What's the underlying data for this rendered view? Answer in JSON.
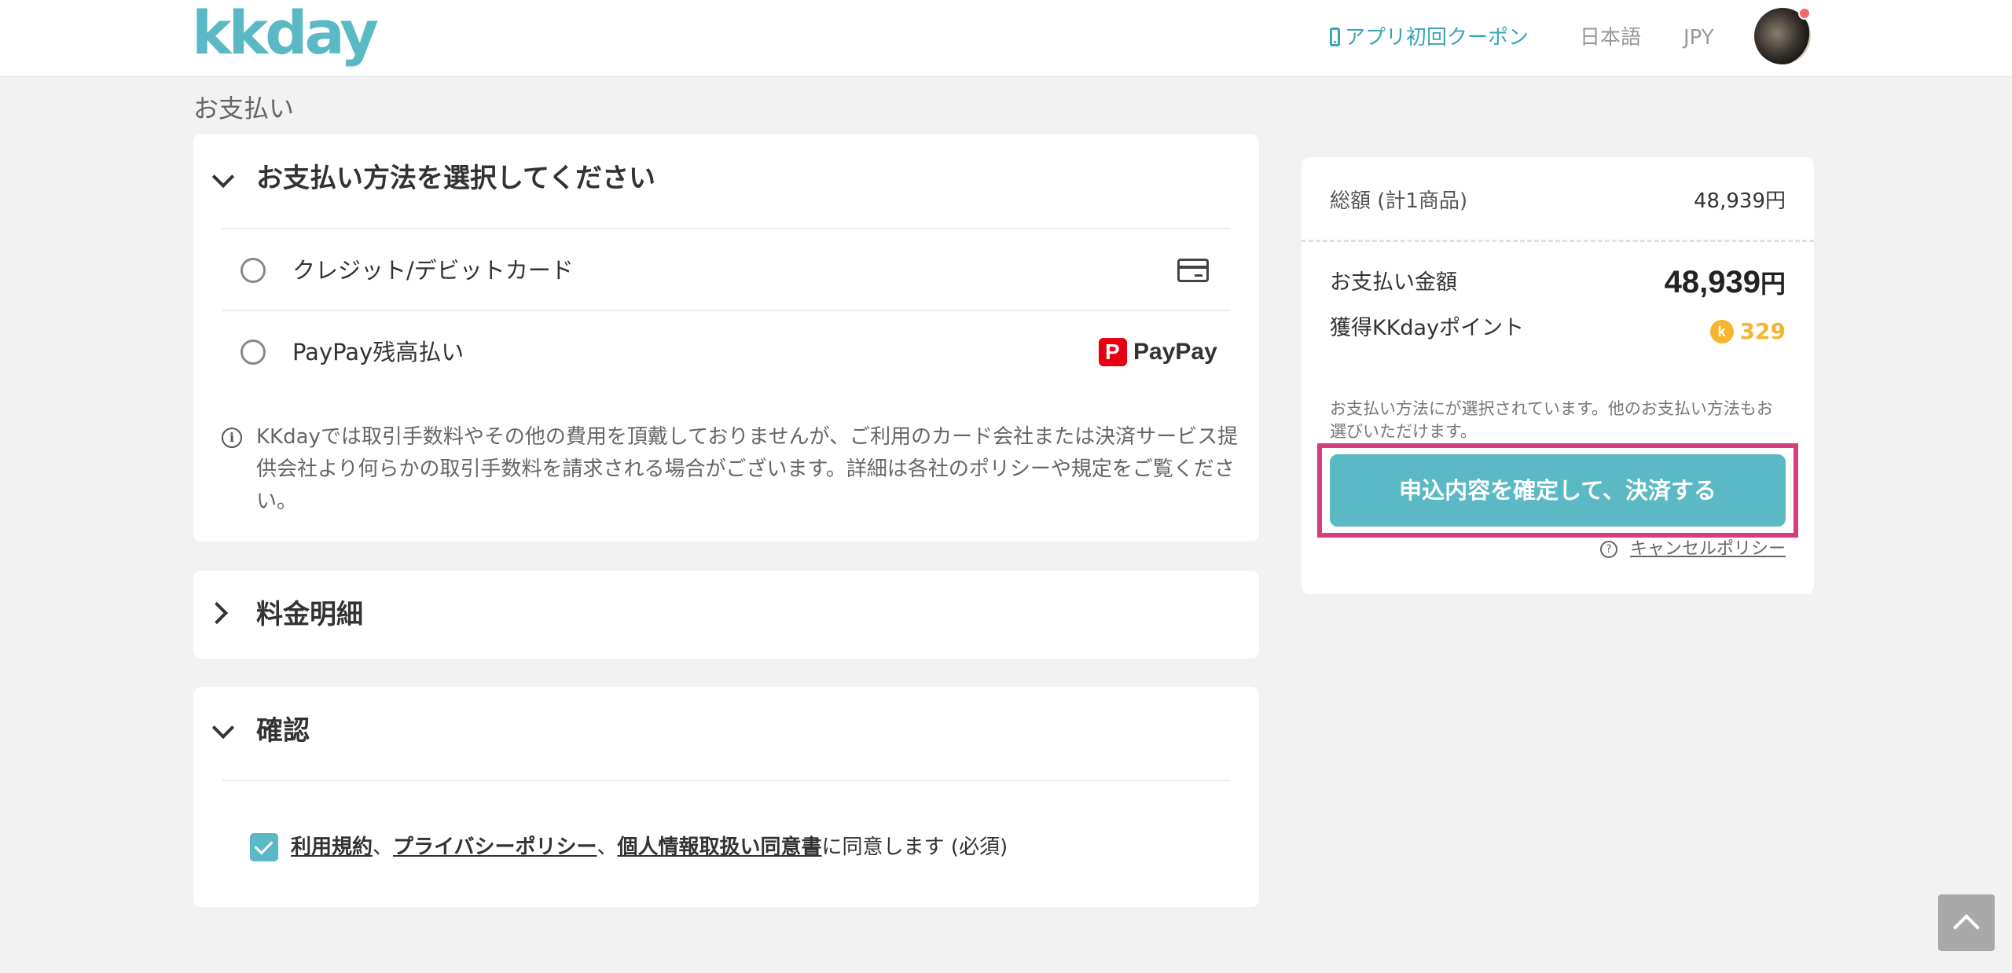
{
  "header": {
    "logo": "kkday",
    "coupon_link": "アプリ初回クーポン",
    "language": "日本語",
    "currency": "JPY"
  },
  "page": {
    "heading": "お支払い"
  },
  "payment_method": {
    "title": "お支払い方法を選択してください",
    "options": [
      {
        "label": "クレジット/デビットカード",
        "icon": "credit-card-icon"
      },
      {
        "label": "PayPay残高払い",
        "icon": "paypay-logo",
        "logo_text": "PayPay"
      }
    ],
    "note": "KKdayでは取引手数料やその他の費用を頂戴しておりませんが、ご利用のカード会社または決済サービス提供会社より何らかの取引手数料を請求される場合がございます。詳細は各社のポリシーや規定をご覧ください。"
  },
  "fee_details": {
    "title": "料金明細"
  },
  "confirmation": {
    "title": "確認",
    "checked": true,
    "terms_link": "利用規約",
    "separator1": "、",
    "privacy_link": "プライバシーポリシー",
    "separator2": "、",
    "personal_info_link": "個人情報取扱い同意書",
    "agree_suffix": "に同意します (必須)"
  },
  "summary": {
    "subtotal_label": "総額 (計1商品)",
    "subtotal_value": "48,939円",
    "total_label": "お支払い金額",
    "total_amount": "48,939",
    "total_yen": "円",
    "points_label": "獲得KKdayポイント",
    "points_icon_letter": "k",
    "points_value": "329",
    "select_note": "お支払い方法にが選択されています。他のお支払い方法もお選びいただけます。",
    "pay_button": "申込内容を確定して、決済する",
    "cancel_policy": "キャンセルポリシー"
  },
  "colors": {
    "accent": "#5ab9c4",
    "highlight": "#d63d7c",
    "points": "#f5b52e"
  }
}
